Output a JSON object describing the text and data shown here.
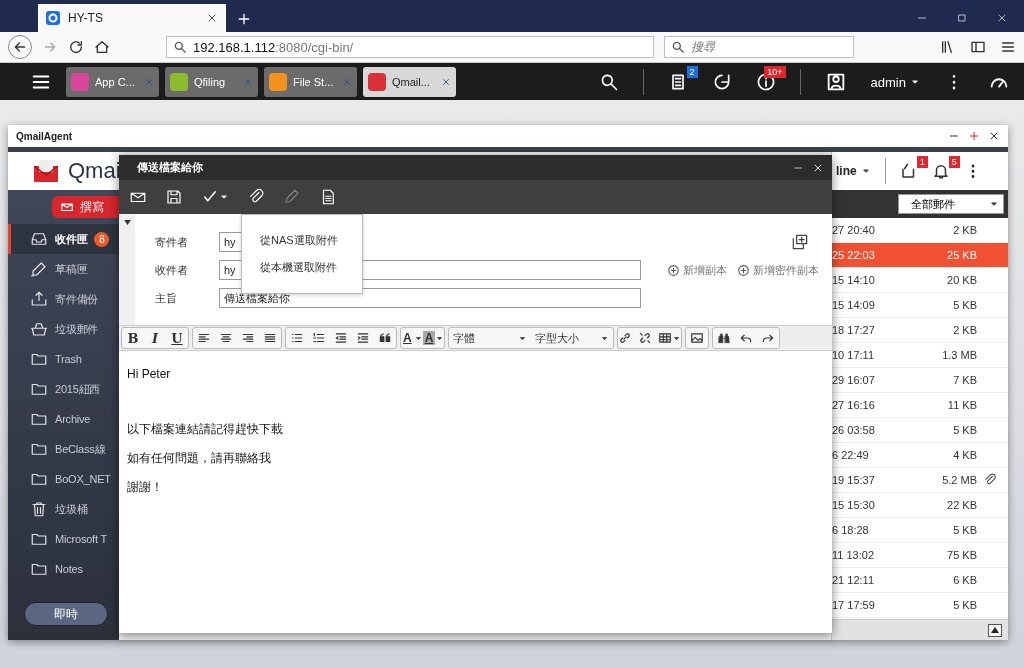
{
  "browser": {
    "tab_title": "HY-TS",
    "url_host": "192.168.1.112",
    "url_path": ":8080/cgi-bin/",
    "search_placeholder": "搜尋"
  },
  "qts_bar": {
    "apps": [
      {
        "label": "App C...",
        "color": "#d8479a",
        "selected": false
      },
      {
        "label": "Qfiling",
        "color": "#8dbb2e",
        "selected": false
      },
      {
        "label": "File St...",
        "color": "#f5921e",
        "selected": false
      },
      {
        "label": "Qmail...",
        "color": "#d9303a",
        "selected": true
      }
    ],
    "task_badge": "2",
    "info_badge": "10+",
    "user": "admin"
  },
  "qmail": {
    "title": "QmailAgent",
    "logo_text": "Qmai",
    "compose": "撰寫",
    "status": "line",
    "header_badges": [
      "1",
      "5"
    ],
    "filter": "全部郵件",
    "folders": [
      {
        "name": "收件匣",
        "kind": "inbox",
        "badge": "8",
        "selected": true
      },
      {
        "name": "草稿匣",
        "kind": "drafts",
        "selected": false
      },
      {
        "name": "寄件備份",
        "kind": "sent",
        "selected": false
      },
      {
        "name": "垃圾郵件",
        "kind": "spam",
        "selected": false
      },
      {
        "name": "Trash",
        "kind": "folder",
        "selected": false
      },
      {
        "name": "2015紐西",
        "kind": "folder",
        "selected": false
      },
      {
        "name": "Archive",
        "kind": "folder",
        "selected": false
      },
      {
        "name": "BeClass線",
        "kind": "folder",
        "selected": false
      },
      {
        "name": "BoOX_NET",
        "kind": "folder",
        "selected": false
      },
      {
        "name": "垃圾桶",
        "kind": "trash",
        "selected": false
      },
      {
        "name": "Microsoft T",
        "kind": "folder",
        "selected": false
      },
      {
        "name": "Notes",
        "kind": "folder",
        "selected": false
      }
    ],
    "sync_button": "即時",
    "rows": [
      {
        "date": "27 20:40",
        "size": "2 KB",
        "attachment": false,
        "selected": false
      },
      {
        "date": "25 22:03",
        "size": "25 KB",
        "attachment": false,
        "selected": true
      },
      {
        "date": "15 14:10",
        "size": "20 KB",
        "attachment": false,
        "selected": false
      },
      {
        "date": "15 14:09",
        "size": "5 KB",
        "attachment": false,
        "selected": false
      },
      {
        "date": "18 17:27",
        "size": "2 KB",
        "attachment": false,
        "selected": false
      },
      {
        "date": "10 17:11",
        "size": "1.3 MB",
        "attachment": false,
        "selected": false
      },
      {
        "date": "29 16:07",
        "size": "7 KB",
        "attachment": false,
        "selected": false
      },
      {
        "date": "27 16:16",
        "size": "11 KB",
        "attachment": false,
        "selected": false
      },
      {
        "date": "26 03:58",
        "size": "5 KB",
        "attachment": false,
        "selected": false
      },
      {
        "date": "6 22:49",
        "size": "4 KB",
        "attachment": false,
        "selected": false
      },
      {
        "date": "19 15:37",
        "size": "5.2 MB",
        "attachment": true,
        "selected": false
      },
      {
        "date": "15 15:30",
        "size": "22 KB",
        "attachment": false,
        "selected": false
      },
      {
        "date": "6 18:28",
        "size": "5 KB",
        "attachment": false,
        "selected": false
      },
      {
        "date": "11 13:02",
        "size": "75 KB",
        "attachment": false,
        "selected": false
      },
      {
        "date": "21 12:11",
        "size": "6 KB",
        "attachment": false,
        "selected": false
      },
      {
        "date": "17 17:59",
        "size": "5 KB",
        "attachment": false,
        "selected": false
      }
    ]
  },
  "compose": {
    "title": "傳送檔案給你",
    "toolbar": [
      {
        "kind": "send",
        "disabled": false
      },
      {
        "kind": "save",
        "disabled": false
      },
      {
        "kind": "spell",
        "disabled": false
      },
      {
        "kind": "attach",
        "disabled": false
      },
      {
        "kind": "signature",
        "disabled": true
      },
      {
        "kind": "note",
        "disabled": false
      }
    ],
    "fields": [
      {
        "label": "寄件者",
        "value": "hy",
        "kind": "select"
      },
      {
        "label": "收件者",
        "value": "hy",
        "kind": "text"
      },
      {
        "label": "主旨",
        "value": "傳送檔案給你",
        "kind": "text"
      }
    ],
    "add_links": [
      "新增副本",
      "新增密件副本"
    ],
    "format_buttons": [
      "B",
      "I",
      "U"
    ],
    "text_color": "A",
    "highlight_color": "A",
    "font": "字體",
    "font_size": "字型大小",
    "body": [
      "Hi Peter",
      "以下檔案連結請記得趕快下載",
      "如有任何問題，請再聯絡我",
      "謝謝！"
    ],
    "attach_menu": [
      "從NAS選取附件",
      "從本機選取附件"
    ]
  }
}
